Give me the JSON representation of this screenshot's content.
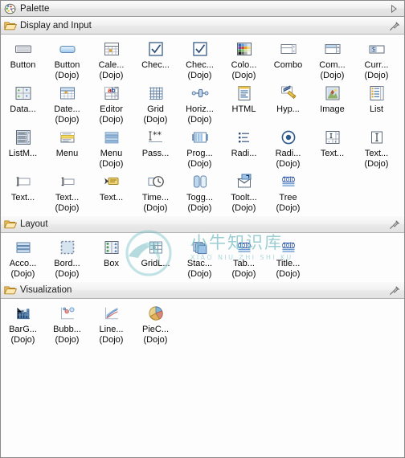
{
  "window": {
    "title": "Palette",
    "title_icon": "palette-icon",
    "expand_arrow_icon": "chevron-right-icon",
    "accent": "#e2e2e2",
    "border": "#8a8a8a"
  },
  "watermark": {
    "line1": "小牛知识库",
    "line2": "XIAO NIU ZHI SHI KU"
  },
  "sections": [
    {
      "label": "Display and Input",
      "icon": "open-folder-icon",
      "pin_icon": "pin-icon",
      "items": [
        {
          "label": "Button",
          "label2": "",
          "icon": "button-icon"
        },
        {
          "label": "Button",
          "label2": "(Dojo)",
          "icon": "dojo-button-icon"
        },
        {
          "label": "Cale...",
          "label2": "(Dojo)",
          "icon": "calendar-icon"
        },
        {
          "label": "Chec...",
          "label2": "",
          "icon": "checkbox-icon"
        },
        {
          "label": "Chec...",
          "label2": "(Dojo)",
          "icon": "dojo-checkbox-icon"
        },
        {
          "label": "Colo...",
          "label2": "(Dojo)",
          "icon": "color-palette-icon"
        },
        {
          "label": "Combo",
          "label2": "",
          "icon": "combobox-icon"
        },
        {
          "label": "Com...",
          "label2": "(Dojo)",
          "icon": "dojo-combobox-icon"
        },
        {
          "label": "Curr...",
          "label2": "(Dojo)",
          "icon": "currency-icon"
        },
        {
          "label": "Data...",
          "label2": "",
          "icon": "datagrid-icon"
        },
        {
          "label": "Date...",
          "label2": "(Dojo)",
          "icon": "datepicker-icon"
        },
        {
          "label": "Editor",
          "label2": "(Dojo)",
          "icon": "editor-icon"
        },
        {
          "label": "Grid",
          "label2": "(Dojo)",
          "icon": "grid-icon"
        },
        {
          "label": "Horiz...",
          "label2": "(Dojo)",
          "icon": "horizontal-slider-icon"
        },
        {
          "label": "HTML",
          "label2": "",
          "icon": "html-icon"
        },
        {
          "label": "Hyp...",
          "label2": "",
          "icon": "hyperlink-icon"
        },
        {
          "label": "Image",
          "label2": "",
          "icon": "image-icon"
        },
        {
          "label": "List",
          "label2": "",
          "icon": "list-icon"
        },
        {
          "label": "ListM...",
          "label2": "",
          "icon": "listmulti-icon"
        },
        {
          "label": "Menu",
          "label2": "",
          "icon": "menu-icon"
        },
        {
          "label": "Menu",
          "label2": "(Dojo)",
          "icon": "dojo-menu-icon"
        },
        {
          "label": "Pass...",
          "label2": "",
          "icon": "password-icon"
        },
        {
          "label": "Prog...",
          "label2": "(Dojo)",
          "icon": "progressbar-icon"
        },
        {
          "label": "Radi...",
          "label2": "",
          "icon": "radio-group-icon"
        },
        {
          "label": "Radi...",
          "label2": "(Dojo)",
          "icon": "dojo-radio-icon"
        },
        {
          "label": "Text...",
          "label2": "",
          "icon": "textfield-grid-icon"
        },
        {
          "label": "Text...",
          "label2": "(Dojo)",
          "icon": "dojo-textbox-icon"
        },
        {
          "label": "Text...",
          "label2": "",
          "icon": "textinput-icon"
        },
        {
          "label": "Text...",
          "label2": "(Dojo)",
          "icon": "dojo-textinput-icon"
        },
        {
          "label": "Text...",
          "label2": "",
          "icon": "textarea-tag-icon"
        },
        {
          "label": "Time...",
          "label2": "(Dojo)",
          "icon": "timepicker-icon"
        },
        {
          "label": "Togg...",
          "label2": "(Dojo)",
          "icon": "toggle-button-icon"
        },
        {
          "label": "Toolt...",
          "label2": "(Dojo)",
          "icon": "tooltip-icon"
        },
        {
          "label": "Tree",
          "label2": "(Dojo)",
          "icon": "dojo-tree-icon"
        }
      ]
    },
    {
      "label": "Layout",
      "icon": "open-folder-icon",
      "pin_icon": "pin-icon",
      "items": [
        {
          "label": "Acco...",
          "label2": "(Dojo)",
          "icon": "accordion-icon"
        },
        {
          "label": "Bord...",
          "label2": "(Dojo)",
          "icon": "border-container-icon"
        },
        {
          "label": "Box",
          "label2": "",
          "icon": "box-icon"
        },
        {
          "label": "GridL...",
          "label2": "",
          "icon": "gridlayout-icon"
        },
        {
          "label": "Stac...",
          "label2": "(Dojo)",
          "icon": "stack-container-icon"
        },
        {
          "label": "Tab...",
          "label2": "(Dojo)",
          "icon": "dojo-tab-icon"
        },
        {
          "label": "Title...",
          "label2": "(Dojo)",
          "icon": "dojo-titlepane-icon"
        }
      ]
    },
    {
      "label": "Visualization",
      "icon": "open-folder-icon",
      "pin_icon": "pin-icon",
      "items": [
        {
          "label": "BarG...",
          "label2": "(Dojo)",
          "icon": "bar-chart-icon"
        },
        {
          "label": "Bubb...",
          "label2": "(Dojo)",
          "icon": "bubble-chart-icon"
        },
        {
          "label": "Line...",
          "label2": "(Dojo)",
          "icon": "line-chart-icon"
        },
        {
          "label": "PieC...",
          "label2": "(Dojo)",
          "icon": "pie-chart-icon"
        }
      ]
    }
  ]
}
